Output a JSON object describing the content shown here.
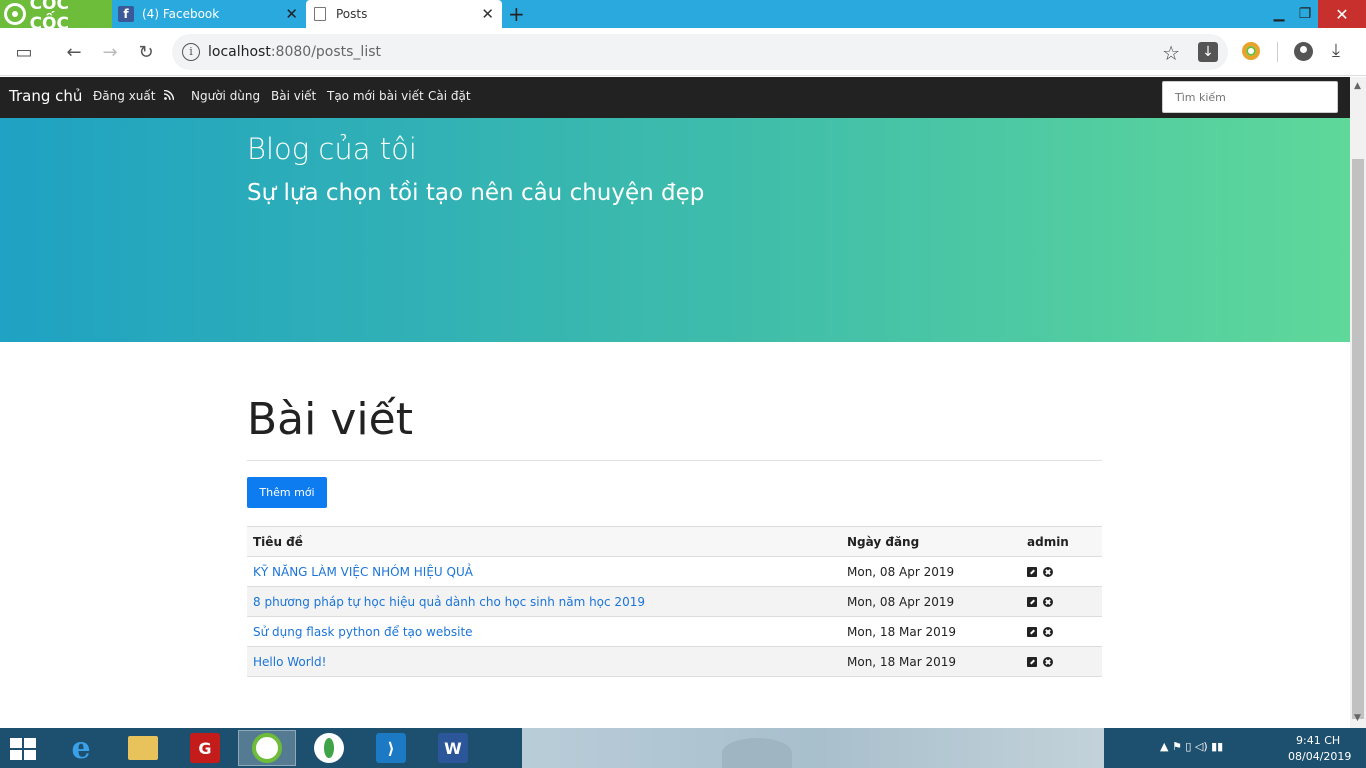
{
  "browser": {
    "brand": "CỐC CỐC",
    "tabs": [
      {
        "label": "(4) Facebook"
      },
      {
        "label": "Posts"
      }
    ],
    "url_host": "localhost",
    "url_rest": ":8080/posts_list"
  },
  "nav": {
    "brand": "Trang chủ",
    "items": [
      "Đăng xuất",
      "Người dùng",
      "Bài viết",
      "Tạo mới bài viết",
      "Cài đặt"
    ],
    "search_placeholder": "Tìm kiếm"
  },
  "hero": {
    "title": "Blog của tôi",
    "subtitle": "Sự lựa chọn tồi tạo nên câu chuyện đẹp"
  },
  "main": {
    "heading": "Bài viết",
    "add_button": "Thêm mới",
    "table": {
      "headers": [
        "Tiêu đề",
        "Ngày đăng",
        "admin"
      ],
      "rows": [
        {
          "title": "KỸ NĂNG LÀM VIỆC NHÓM HIỆU QUẢ",
          "date": "Mon, 08 Apr 2019"
        },
        {
          "title": "8 phương pháp tự học hiệu quả dành cho học sinh năm học 2019",
          "date": "Mon, 08 Apr 2019"
        },
        {
          "title": "Sử dụng flask python để tạo website",
          "date": "Mon, 18 Mar 2019"
        },
        {
          "title": "Hello World!",
          "date": "Mon, 18 Mar 2019"
        }
      ]
    }
  },
  "taskbar": {
    "time": "9:41 CH",
    "date": "08/04/2019"
  },
  "colors": {
    "accent": "#0d7cf1",
    "navbar": "#222222",
    "hero_start": "#1fa2c3",
    "hero_end": "#5fd89a",
    "link": "#1b74d8"
  }
}
